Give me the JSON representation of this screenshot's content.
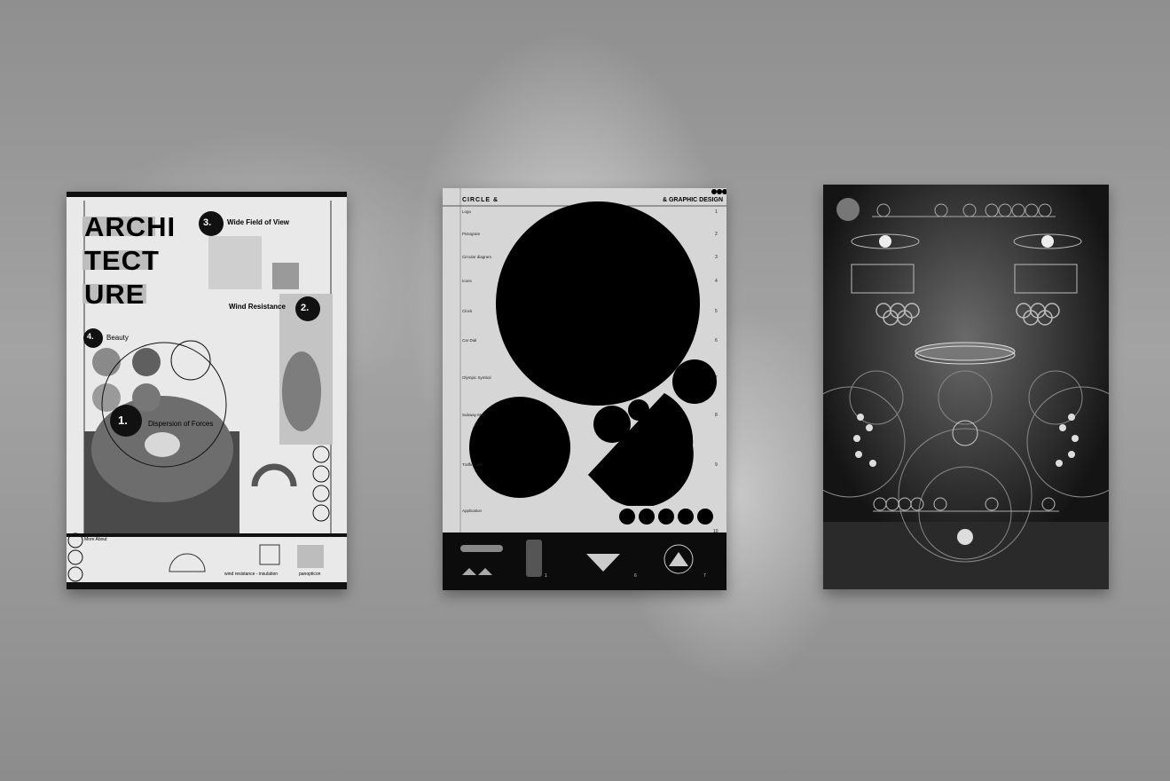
{
  "poster_architecture": {
    "title_line_1": "ARCHI",
    "title_line_2": "TECT",
    "title_line_3": "URE",
    "section_3_number": "3.",
    "section_3_label": "Wide Field of View",
    "section_2_number": "2.",
    "section_2_label": "Wind Resistance",
    "section_4_number": "4.",
    "section_4_label": "Beauty",
    "section_1_number": "1.",
    "section_1_label": "Dispersion of Forces",
    "footer_heading": "More About",
    "footer_caption_1": "wind resistance - insulation",
    "footer_caption_2": "panopticon"
  },
  "poster_circle": {
    "header_left": "CIRCLE &",
    "header_right": "& GRAPHIC DESIGN",
    "index_items": [
      "Logo",
      "Pictogram",
      "Circular diagram",
      "Icons",
      "Clock",
      "Car Dial",
      "Olympic Symbol",
      "Subway Map",
      "Traffic Light",
      "Application"
    ],
    "index_numbers": [
      "1",
      "2",
      "3",
      "4",
      "5",
      "6",
      "7",
      "8",
      "9",
      "10"
    ],
    "footer_numbers": [
      "1",
      "6",
      "7"
    ]
  },
  "poster_olympic": {},
  "colors": {
    "wall": "#9a9a9a",
    "poster_light": "#e9e9e9",
    "poster_dark": "#1b1b1b",
    "ink": "#000000"
  }
}
